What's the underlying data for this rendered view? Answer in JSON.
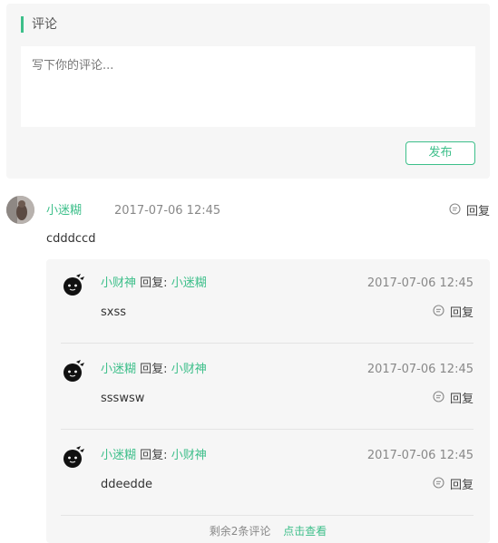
{
  "panel": {
    "title": "评论",
    "placeholder": "写下你的评论...",
    "publish_label": "发布"
  },
  "comment": {
    "user": "小迷糊",
    "time": "2017-07-06 12:45",
    "reply_label": "回复",
    "text": "cdddccd"
  },
  "replies": [
    {
      "user": "小财神",
      "reply_word": "回复:",
      "target": "小迷糊",
      "time": "2017-07-06 12:45",
      "text": "sxss",
      "reply_label": "回复"
    },
    {
      "user": "小迷糊",
      "reply_word": "回复:",
      "target": "小财神",
      "time": "2017-07-06 12:45",
      "text": "ssswsw",
      "reply_label": "回复"
    },
    {
      "user": "小迷糊",
      "reply_word": "回复:",
      "target": "小财神",
      "time": "2017-07-06 12:45",
      "text": "ddeedde",
      "reply_label": "回复"
    }
  ],
  "more": {
    "remaining": "剩余2条评论",
    "view": "点击查看"
  },
  "colors": {
    "accent": "#3dbf8a",
    "panel_bg": "#f6f6f6"
  },
  "icons": {
    "reply": "chat-bubble-icon",
    "reply_avatar": "cartoon-face-avatar"
  }
}
